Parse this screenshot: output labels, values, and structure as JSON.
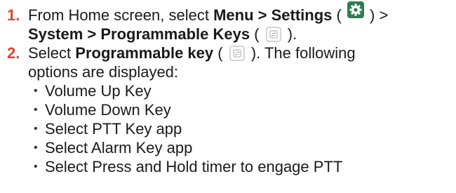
{
  "colors": {
    "step_number": "#e0442b",
    "text": "#1a1a1a",
    "settings_icon_bg": "#2e7d4f"
  },
  "step1": {
    "number": "1.",
    "text_before": "From Home screen, select ",
    "bold_path_1": "Menu > Settings",
    "paren_open_1": " ( ",
    "settings_icon": "settings-gear-icon",
    "paren_close_1": " ) >",
    "bold_path_2": "System > Programmable Keys",
    "paren_open_2": " ( ",
    "pk_icon": "programmable-keys-icon",
    "paren_close_2": " )."
  },
  "step2": {
    "number": "2.",
    "text_before": "Select ",
    "bold_label": "Programmable key",
    "paren_open": " ( ",
    "pk_icon": "programmable-keys-icon",
    "paren_close": " ). The following",
    "text_line2": "options are displayed:",
    "options": [
      "Volume Up Key",
      "Volume Down Key",
      "Select PTT Key app",
      "Select Alarm Key app",
      "Select Press and Hold timer to engage PTT"
    ]
  }
}
